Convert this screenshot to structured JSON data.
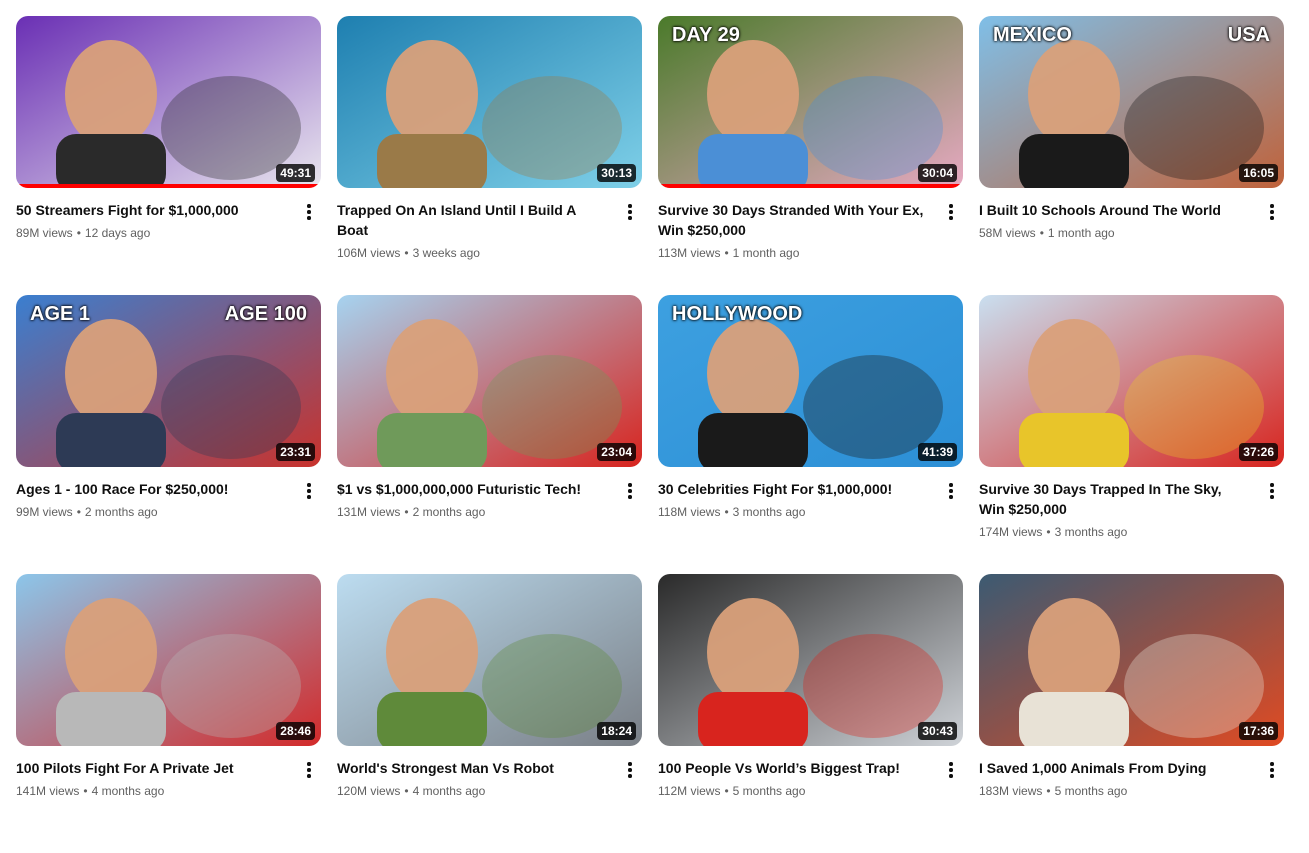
{
  "videos": [
    {
      "title": "50 Streamers Fight for $1,000,000",
      "views": "89M views",
      "age": "12 days ago",
      "duration": "49:31",
      "watched_fraction": 1.0,
      "thumb_colors": [
        "#6a2fb4",
        "#e9e6ee",
        "#2a2a2a"
      ]
    },
    {
      "title": "Trapped On An Island Until I Build A Boat",
      "views": "106M views",
      "age": "3 weeks ago",
      "duration": "30:13",
      "watched_fraction": 0,
      "thumb_colors": [
        "#1e7fb0",
        "#7fd0e8",
        "#9a7a48"
      ]
    },
    {
      "title": "Survive 30 Days Stranded With Your Ex, Win $250,000",
      "views": "113M views",
      "age": "1 month ago",
      "duration": "30:04",
      "watched_fraction": 1.0,
      "thumb_text": "DAY 29",
      "thumb_colors": [
        "#4a7a2a",
        "#e7a9c2",
        "#4b8fd6"
      ]
    },
    {
      "title": "I Built 10 Schools Around The World",
      "views": "58M views",
      "age": "1 month ago",
      "duration": "16:05",
      "watched_fraction": 0,
      "thumb_text": "MEXICO",
      "thumb_text_2": "USA",
      "thumb_colors": [
        "#7fbfe8",
        "#c0623a",
        "#1a1a1a"
      ]
    },
    {
      "title": "Ages 1 - 100 Race For $250,000!",
      "views": "99M views",
      "age": "2 months ago",
      "duration": "23:31",
      "watched_fraction": 0,
      "thumb_text": "AGE 1",
      "thumb_text_2": "AGE 100",
      "thumb_colors": [
        "#3a7fd0",
        "#c9322c",
        "#2d3a55"
      ]
    },
    {
      "title": "$1 vs $1,000,000,000 Futuristic Tech!",
      "views": "131M views",
      "age": "2 months ago",
      "duration": "23:04",
      "watched_fraction": 0,
      "thumb_colors": [
        "#a6d3f0",
        "#d8241e",
        "#6f9a5a"
      ]
    },
    {
      "title": "30 Celebrities Fight For $1,000,000!",
      "views": "118M views",
      "age": "3 months ago",
      "duration": "41:39",
      "watched_fraction": 0,
      "thumb_text": "HOLLYWOOD",
      "thumb_colors": [
        "#3da0e0",
        "#2c8fd6",
        "#1a1a1a"
      ]
    },
    {
      "title": "Survive 30 Days Trapped In The Sky, Win $250,000",
      "views": "174M views",
      "age": "3 months ago",
      "duration": "37:26",
      "watched_fraction": 0,
      "thumb_colors": [
        "#c9dff0",
        "#d8241e",
        "#e8c52a"
      ]
    },
    {
      "title": "100 Pilots Fight For A Private Jet",
      "views": "141M views",
      "age": "4 months ago",
      "duration": "28:46",
      "watched_fraction": 0,
      "thumb_colors": [
        "#8cc6ea",
        "#d32a2a",
        "#b8b8b8"
      ]
    },
    {
      "title": "World's Strongest Man Vs Robot",
      "views": "120M views",
      "age": "4 months ago",
      "duration": "18:24",
      "watched_fraction": 0,
      "thumb_colors": [
        "#bcdcf0",
        "#7a7f86",
        "#5f8a3a"
      ]
    },
    {
      "title": "100 People Vs World’s Biggest Trap!",
      "views": "112M views",
      "age": "5 months ago",
      "duration": "30:43",
      "watched_fraction": 0,
      "thumb_colors": [
        "#2a2a2a",
        "#cfd3d8",
        "#d8241e"
      ]
    },
    {
      "title": "I Saved 1,000 Animals From Dying",
      "views": "183M views",
      "age": "5 months ago",
      "duration": "17:36",
      "watched_fraction": 0,
      "thumb_colors": [
        "#3c5a72",
        "#e04a22",
        "#e8e2d6"
      ]
    }
  ],
  "icons": {
    "more": "more-vert-icon"
  },
  "colors": {
    "progress": "#ff0000",
    "title": "#0f0f0f",
    "meta": "#606060"
  }
}
